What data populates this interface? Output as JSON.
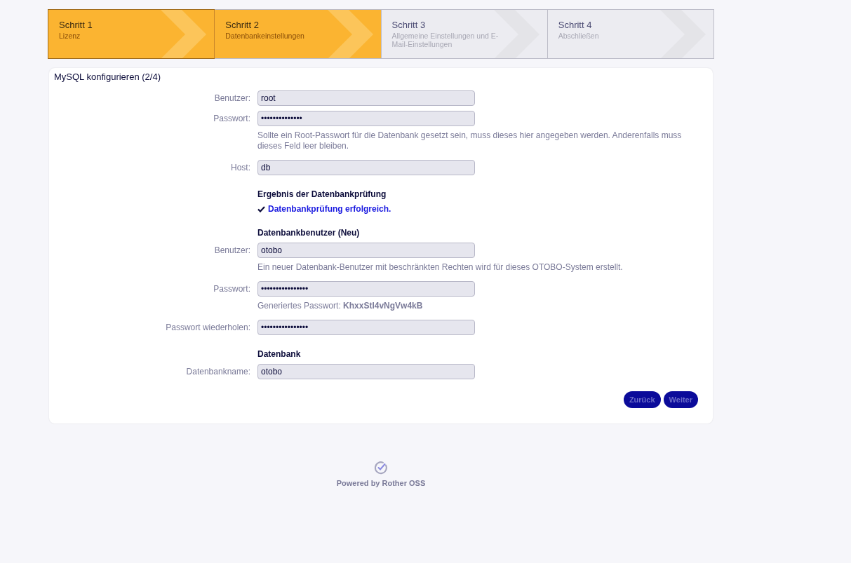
{
  "steps": [
    {
      "step": "Schritt 1",
      "name": "Lizenz",
      "reached": true
    },
    {
      "step": "Schritt 2",
      "name": "Datenbankeinstellungen",
      "reached": true
    },
    {
      "step": "Schritt 3",
      "name": "Allgemeine Einstellungen und E-Mail-Einstellungen",
      "reached": false
    },
    {
      "step": "Schritt 4",
      "name": "Abschließen",
      "reached": false
    }
  ],
  "card": {
    "title": "MySQL konfigurieren (2/4)",
    "rows": [
      {
        "kind": "field",
        "label": "Benutzer:",
        "value": "root"
      },
      {
        "kind": "field",
        "label": "Passwort:",
        "value": "••••••••••••••"
      },
      {
        "kind": "hint",
        "text": "Sollte ein Root-Passwort für die Datenbank gesetzt sein, muss dieses hier angegeben werden. Anderenfalls muss dieses Feld leer bleiben."
      },
      {
        "kind": "field",
        "label": "Host:",
        "value": "db"
      },
      {
        "kind": "heading",
        "text": "Ergebnis der Datenbankprüfung"
      },
      {
        "kind": "status",
        "text": "Datenbankprüfung erfolgreich."
      },
      {
        "kind": "heading",
        "text": "Datenbankbenutzer (Neu)"
      },
      {
        "kind": "field",
        "label": "Benutzer:",
        "value": "otobo"
      },
      {
        "kind": "hint",
        "text": "Ein neuer Datenbank-Benutzer mit beschränkten Rechten wird für dieses OTOBO-System erstellt."
      },
      {
        "kind": "field",
        "label": "Passwort:",
        "value": "••••••••••••••••"
      },
      {
        "kind": "hint",
        "text": "Generiertes Passwort: **KhxxStl4vNgVw4kB**"
      },
      {
        "kind": "field",
        "label": "Passwort wiederholen:",
        "value": "••••••••••••••••"
      },
      {
        "kind": "heading",
        "text": "Datenbank"
      },
      {
        "kind": "field",
        "label": "Datenbankname:",
        "value": "otobo"
      }
    ],
    "buttons": [
      "Zurück",
      "Weiter"
    ]
  },
  "footer": {
    "text": "Powered by Rother OSS"
  }
}
